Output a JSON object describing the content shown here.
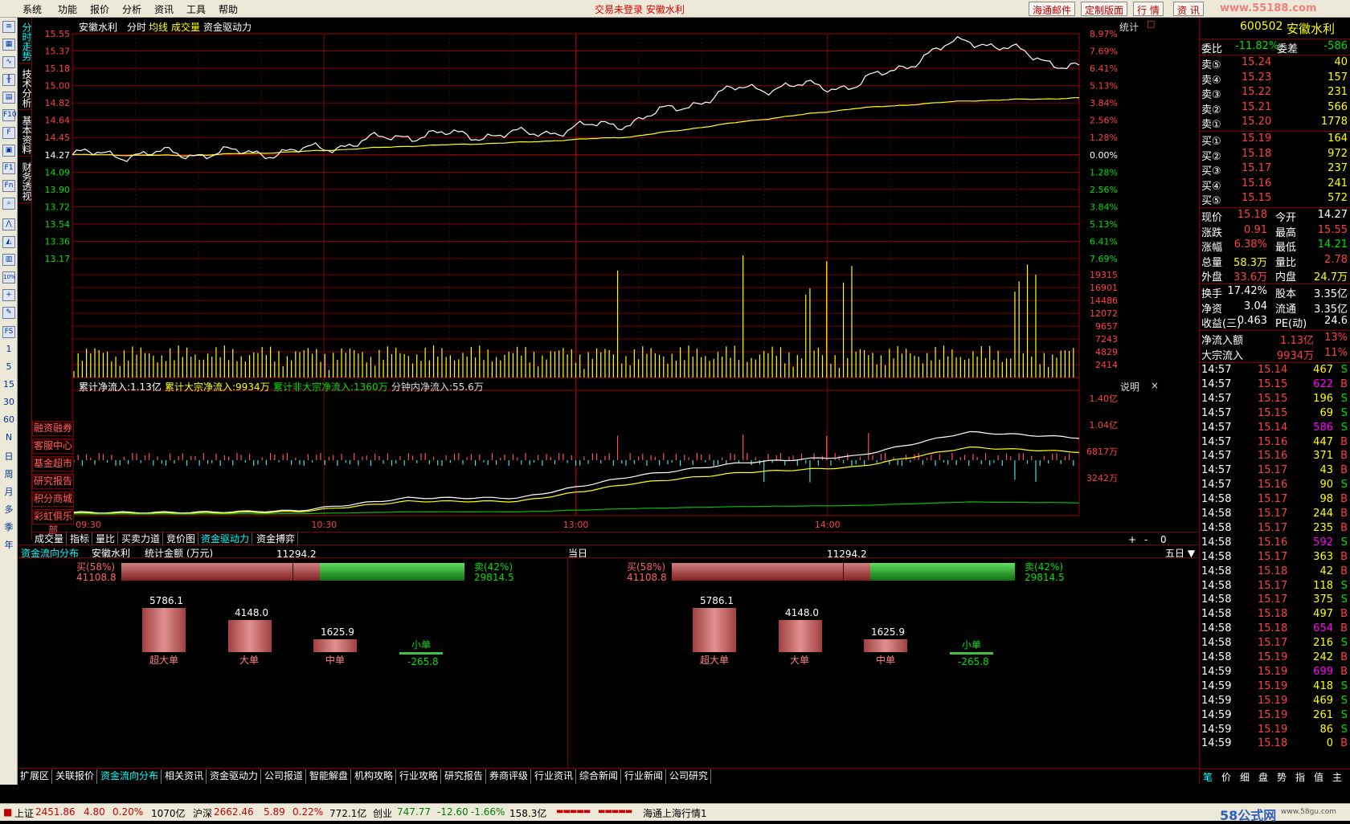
{
  "menu": {
    "items": [
      "系统",
      "功能",
      "报价",
      "分析",
      "资讯",
      "工具",
      "帮助"
    ],
    "center_message": "交易未登录  安徽水利",
    "right_buttons": [
      "海通邮件",
      "定制版面",
      "行 情",
      "资 讯"
    ],
    "watermark": "www.55188.com"
  },
  "left_toolbar": {
    "icons": [
      "quote-list-icon",
      "grid-icon",
      "line-chart-icon",
      "candle-chart-icon",
      "table-icon",
      "f10-icon",
      "f10-news-icon",
      "news-icon",
      "f1-icon",
      "fn-icon",
      "f-icon",
      "search-icon",
      "line-icon",
      "area-icon",
      "bar-icon",
      "percent-icon",
      "plus-icon",
      "pen-icon",
      "fs-icon"
    ],
    "labels": [
      "1",
      "5",
      "15",
      "30",
      "60",
      "N",
      "日",
      "周",
      "月",
      "多",
      "季",
      "年"
    ]
  },
  "vertical_tabs": [
    "分时走势",
    "技术分析",
    "基本资料",
    "财务透视"
  ],
  "chart": {
    "stock_name": "安徽水利",
    "header_items": [
      "分时",
      "均线",
      "成交量",
      "资金驱动力"
    ],
    "stat_label": "统计",
    "price_ticks": [
      "15.55",
      "15.37",
      "15.18",
      "15.00",
      "14.82",
      "14.64",
      "14.45",
      "14.27",
      "14.09",
      "13.90",
      "13.72",
      "13.54",
      "13.36",
      "13.17"
    ],
    "pct_ticks": [
      "8.97%",
      "7.69%",
      "6.41%",
      "5.13%",
      "3.84%",
      "2.56%",
      "1.28%",
      "0.00%",
      "1.28%",
      "2.56%",
      "3.84%",
      "5.13%",
      "6.41%",
      "7.69%"
    ],
    "vol_ticks": [
      "19315",
      "16901",
      "14486",
      "12072",
      "9657",
      "7243",
      "4829",
      "2414"
    ],
    "flow_header": {
      "total_net": "累计净流入:1.13亿",
      "block_net": "累计大宗净流入:9934万",
      "nonblock_net": "累计非大宗净流入:1360万",
      "minute_net": "分钟内净流入:55.6万",
      "explain": "说明"
    },
    "flow_ticks": [
      "1.40亿",
      "1.04亿",
      "6817万",
      "3242万"
    ],
    "time_ticks": [
      "09:30",
      "10:30",
      "13:00",
      "14:00"
    ],
    "side_buttons": [
      "融资融券",
      "客服中心",
      "基金超市",
      "研究报告",
      "积分商城",
      "彩虹俱乐部"
    ],
    "bottom_tabs": [
      "成交量",
      "指标",
      "量比",
      "买卖力道",
      "竞价图",
      "资金驱动力",
      "资金搏弈"
    ],
    "zoom_controls": [
      "+",
      "-",
      "0"
    ],
    "colors": {
      "price_line": "#ffffff",
      "avg_line": "#ffff00",
      "volume": "#ffff00",
      "grid": "#a00000"
    }
  },
  "chart_data": {
    "type": "line",
    "title": "安徽水利 分时",
    "x": [
      "09:30",
      "10:00",
      "10:30",
      "11:00",
      "11:30",
      "13:00",
      "13:30",
      "14:00",
      "14:30",
      "15:00"
    ],
    "series": [
      {
        "name": "分时",
        "values": [
          14.27,
          14.28,
          14.3,
          14.48,
          14.48,
          14.62,
          14.98,
          15.0,
          15.5,
          15.18
        ]
      },
      {
        "name": "均线",
        "values": [
          14.27,
          14.26,
          14.3,
          14.36,
          14.4,
          14.46,
          14.62,
          14.76,
          14.84,
          14.87
        ]
      }
    ],
    "ylim": [
      13.17,
      15.55
    ]
  },
  "analysis": {
    "title": "资金流向分布",
    "stock": "安徽水利",
    "unit": "统计金额 (万元)",
    "panels": [
      {
        "period": "当日",
        "total": "11294.2",
        "buy_label": "买(58%)",
        "buy_value": "41108.8",
        "sell_label": "卖(42%)",
        "sell_value": "29814.5",
        "bars": [
          {
            "label": "超大单",
            "value": "5786.1"
          },
          {
            "label": "大单",
            "value": "4148.0"
          },
          {
            "label": "中单",
            "value": "1625.9"
          },
          {
            "label": "小单",
            "value": "-265.8"
          }
        ]
      },
      {
        "period": "五日",
        "total": "11294.2",
        "buy_label": "买(58%)",
        "buy_value": "41108.8",
        "sell_label": "卖(42%)",
        "sell_value": "29814.5",
        "bars": [
          {
            "label": "超大单",
            "value": "5786.1"
          },
          {
            "label": "大单",
            "value": "4148.0"
          },
          {
            "label": "中单",
            "value": "1625.9"
          },
          {
            "label": "小单",
            "value": "-265.8"
          }
        ]
      }
    ]
  },
  "bottom_tabs": [
    "扩展区",
    "关联报价",
    "资金流向分布",
    "相关资讯",
    "资金驱动力",
    "公司报道",
    "智能解盘",
    "机构攻略",
    "行业攻略",
    "研究报告",
    "券商评级",
    "行业资讯",
    "综合新闻",
    "行业新闻",
    "公司研究"
  ],
  "quote": {
    "code": "600502",
    "name": "安徽水利",
    "weibi_label": "委比",
    "weibi": "-11.82%",
    "weicha_label": "委差",
    "weicha": "-586",
    "asks": [
      {
        "label": "卖⑤",
        "price": "15.24",
        "vol": "40"
      },
      {
        "label": "卖④",
        "price": "15.23",
        "vol": "157"
      },
      {
        "label": "卖③",
        "price": "15.22",
        "vol": "231"
      },
      {
        "label": "卖②",
        "price": "15.21",
        "vol": "566"
      },
      {
        "label": "卖①",
        "price": "15.20",
        "vol": "1778"
      }
    ],
    "bids": [
      {
        "label": "买①",
        "price": "15.19",
        "vol": "164"
      },
      {
        "label": "买②",
        "price": "15.18",
        "vol": "972"
      },
      {
        "label": "买③",
        "price": "15.17",
        "vol": "237"
      },
      {
        "label": "买④",
        "price": "15.16",
        "vol": "241"
      },
      {
        "label": "买⑤",
        "price": "15.15",
        "vol": "572"
      }
    ],
    "stats": [
      {
        "l1": "现价",
        "v1": "15.18",
        "l2": "今开",
        "v2": "14.27"
      },
      {
        "l1": "涨跌",
        "v1": "0.91",
        "l2": "最高",
        "v2": "15.55"
      },
      {
        "l1": "涨幅",
        "v1": "6.38%",
        "l2": "最低",
        "v2": "14.21"
      },
      {
        "l1": "总量",
        "v1": "58.3万",
        "l2": "量比",
        "v2": "2.78"
      },
      {
        "l1": "外盘",
        "v1": "33.6万",
        "l2": "内盘",
        "v2": "24.7万"
      }
    ],
    "fund": [
      {
        "l1": "换手",
        "v1": "17.42%",
        "l2": "股本",
        "v2": "3.35亿"
      },
      {
        "l1": "净资",
        "v1": "3.04",
        "l2": "流通",
        "v2": "3.35亿"
      },
      {
        "l1": "收益(三)",
        "v1": "0.463",
        "l2": "PE(动)",
        "v2": "24.6"
      }
    ],
    "flow": [
      {
        "label": "净流入额",
        "value": "1.13亿",
        "pct": "13%"
      },
      {
        "label": "大宗流入",
        "value": "9934万",
        "pct": "11%"
      }
    ],
    "ticks": [
      {
        "t": "14:57",
        "p": "15.14",
        "v": "467",
        "s": "S",
        "vc": "w"
      },
      {
        "t": "14:57",
        "p": "15.15",
        "v": "622",
        "s": "B",
        "vc": "m"
      },
      {
        "t": "14:57",
        "p": "15.15",
        "v": "196",
        "s": "S",
        "vc": "w"
      },
      {
        "t": "14:57",
        "p": "15.15",
        "v": "69",
        "s": "S",
        "vc": "w"
      },
      {
        "t": "14:57",
        "p": "15.14",
        "v": "586",
        "s": "S",
        "vc": "m"
      },
      {
        "t": "14:57",
        "p": "15.16",
        "v": "447",
        "s": "B",
        "vc": "w"
      },
      {
        "t": "14:57",
        "p": "15.16",
        "v": "371",
        "s": "B",
        "vc": "w"
      },
      {
        "t": "14:57",
        "p": "15.17",
        "v": "43",
        "s": "B",
        "vc": "w"
      },
      {
        "t": "14:57",
        "p": "15.16",
        "v": "90",
        "s": "S",
        "vc": "w"
      },
      {
        "t": "14:58",
        "p": "15.17",
        "v": "98",
        "s": "B",
        "vc": "w"
      },
      {
        "t": "14:58",
        "p": "15.17",
        "v": "244",
        "s": "B",
        "vc": "w"
      },
      {
        "t": "14:58",
        "p": "15.17",
        "v": "235",
        "s": "B",
        "vc": "w"
      },
      {
        "t": "14:58",
        "p": "15.16",
        "v": "592",
        "s": "S",
        "vc": "m"
      },
      {
        "t": "14:58",
        "p": "15.17",
        "v": "363",
        "s": "B",
        "vc": "w"
      },
      {
        "t": "14:58",
        "p": "15.18",
        "v": "42",
        "s": "B",
        "vc": "w"
      },
      {
        "t": "14:58",
        "p": "15.17",
        "v": "118",
        "s": "S",
        "vc": "w"
      },
      {
        "t": "14:58",
        "p": "15.17",
        "v": "375",
        "s": "S",
        "vc": "w"
      },
      {
        "t": "14:58",
        "p": "15.18",
        "v": "497",
        "s": "B",
        "vc": "w"
      },
      {
        "t": "14:58",
        "p": "15.18",
        "v": "654",
        "s": "B",
        "vc": "m"
      },
      {
        "t": "14:58",
        "p": "15.17",
        "v": "216",
        "s": "S",
        "vc": "w"
      },
      {
        "t": "14:58",
        "p": "15.19",
        "v": "242",
        "s": "B",
        "vc": "w"
      },
      {
        "t": "14:59",
        "p": "15.19",
        "v": "699",
        "s": "B",
        "vc": "m"
      },
      {
        "t": "14:59",
        "p": "15.19",
        "v": "418",
        "s": "S",
        "vc": "w"
      },
      {
        "t": "14:59",
        "p": "15.19",
        "v": "469",
        "s": "S",
        "vc": "w"
      },
      {
        "t": "14:59",
        "p": "15.19",
        "v": "261",
        "s": "S",
        "vc": "w"
      },
      {
        "t": "14:59",
        "p": "15.19",
        "v": "86",
        "s": "S",
        "vc": "w"
      },
      {
        "t": "14:59",
        "p": "15.18",
        "v": "0",
        "s": "B",
        "vc": "w"
      }
    ],
    "bottom_tabs": [
      "笔",
      "价",
      "细",
      "盘",
      "势",
      "指",
      "值",
      "主"
    ]
  },
  "status": {
    "sh_label": "上证",
    "sh_val": "2451.86",
    "sh_chg": "4.80",
    "sh_pct": "0.20%",
    "sh_amt": "1070亿",
    "sz_label": "沪深",
    "sz_val": "2662.46",
    "sz_chg": "5.89",
    "sz_pct": "0.22%",
    "sz_amt": "772.1亿",
    "cy_label": "创业",
    "cy_val": "747.77",
    "cy_chg": "-12.60",
    "cy_pct": "-1.66%",
    "cy_amt": "158.3亿",
    "server": "海通上海行情1",
    "logo": "58公式网",
    "logo_url": "www.58gu.com"
  }
}
